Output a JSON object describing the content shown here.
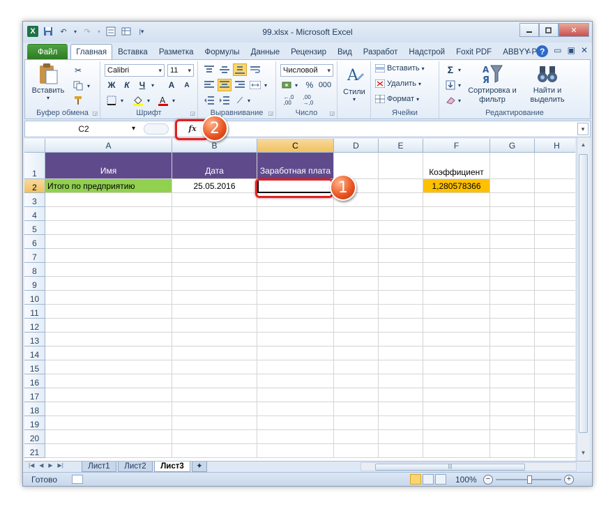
{
  "window": {
    "title": "99.xlsx - Microsoft Excel",
    "controls": {
      "minimize": "▭",
      "restore": "▭",
      "close": "✕"
    }
  },
  "tabs": [
    "Файл",
    "Главная",
    "Вставка",
    "Разметка",
    "Формулы",
    "Данные",
    "Рецензир",
    "Вид",
    "Разработ",
    "Надстрой",
    "Foxit PDF",
    "ABBYY PDF"
  ],
  "ribbon": {
    "clipboard": {
      "label": "Буфер обмена",
      "paste": "Вставить"
    },
    "font": {
      "label": "Шрифт",
      "name": "Calibri",
      "size": "11",
      "bold": "Ж",
      "italic": "К",
      "underline": "Ч",
      "grow": "A",
      "shrink": "A"
    },
    "alignment": {
      "label": "Выравнивание"
    },
    "number": {
      "label": "Число",
      "format": "Числовой",
      "percent": "%",
      "thousands": "000"
    },
    "styles": {
      "label": "Стили",
      "button": "Стили"
    },
    "cells": {
      "label": "Ячейки",
      "insert": "Вставить",
      "delete": "Удалить",
      "format": "Формат"
    },
    "editing": {
      "label": "Редактирование",
      "sort": "Сортировка и фильтр",
      "find": "Найти и выделить"
    }
  },
  "formula_bar": {
    "name_box": "C2",
    "fx": "fx",
    "formula": ""
  },
  "columns": [
    "A",
    "B",
    "C",
    "D",
    "E",
    "F",
    "G",
    "H"
  ],
  "rows": [
    "1",
    "2",
    "3",
    "4",
    "5",
    "6",
    "7",
    "8",
    "9",
    "10",
    "11",
    "12",
    "13",
    "14",
    "15",
    "16",
    "17",
    "18",
    "19",
    "20",
    "21"
  ],
  "cells": {
    "A1": "Имя",
    "B1": "Дата",
    "C1": "Заработная плата",
    "F1": "Коэффициент",
    "A2": "Итого по предприятию",
    "B2": "25.05.2016",
    "C2": "",
    "F2": "1,280578366"
  },
  "sheets": [
    "Лист1",
    "Лист2",
    "Лист3"
  ],
  "active_sheet": "Лист3",
  "status": {
    "ready": "Готово",
    "zoom": "100%"
  },
  "callouts": {
    "one": "1",
    "two": "2"
  },
  "colors": {
    "header_fill": "#5f4b8b",
    "total_fill": "#92d050",
    "coef_fill": "#ffc000",
    "callout": "#e8501e"
  }
}
